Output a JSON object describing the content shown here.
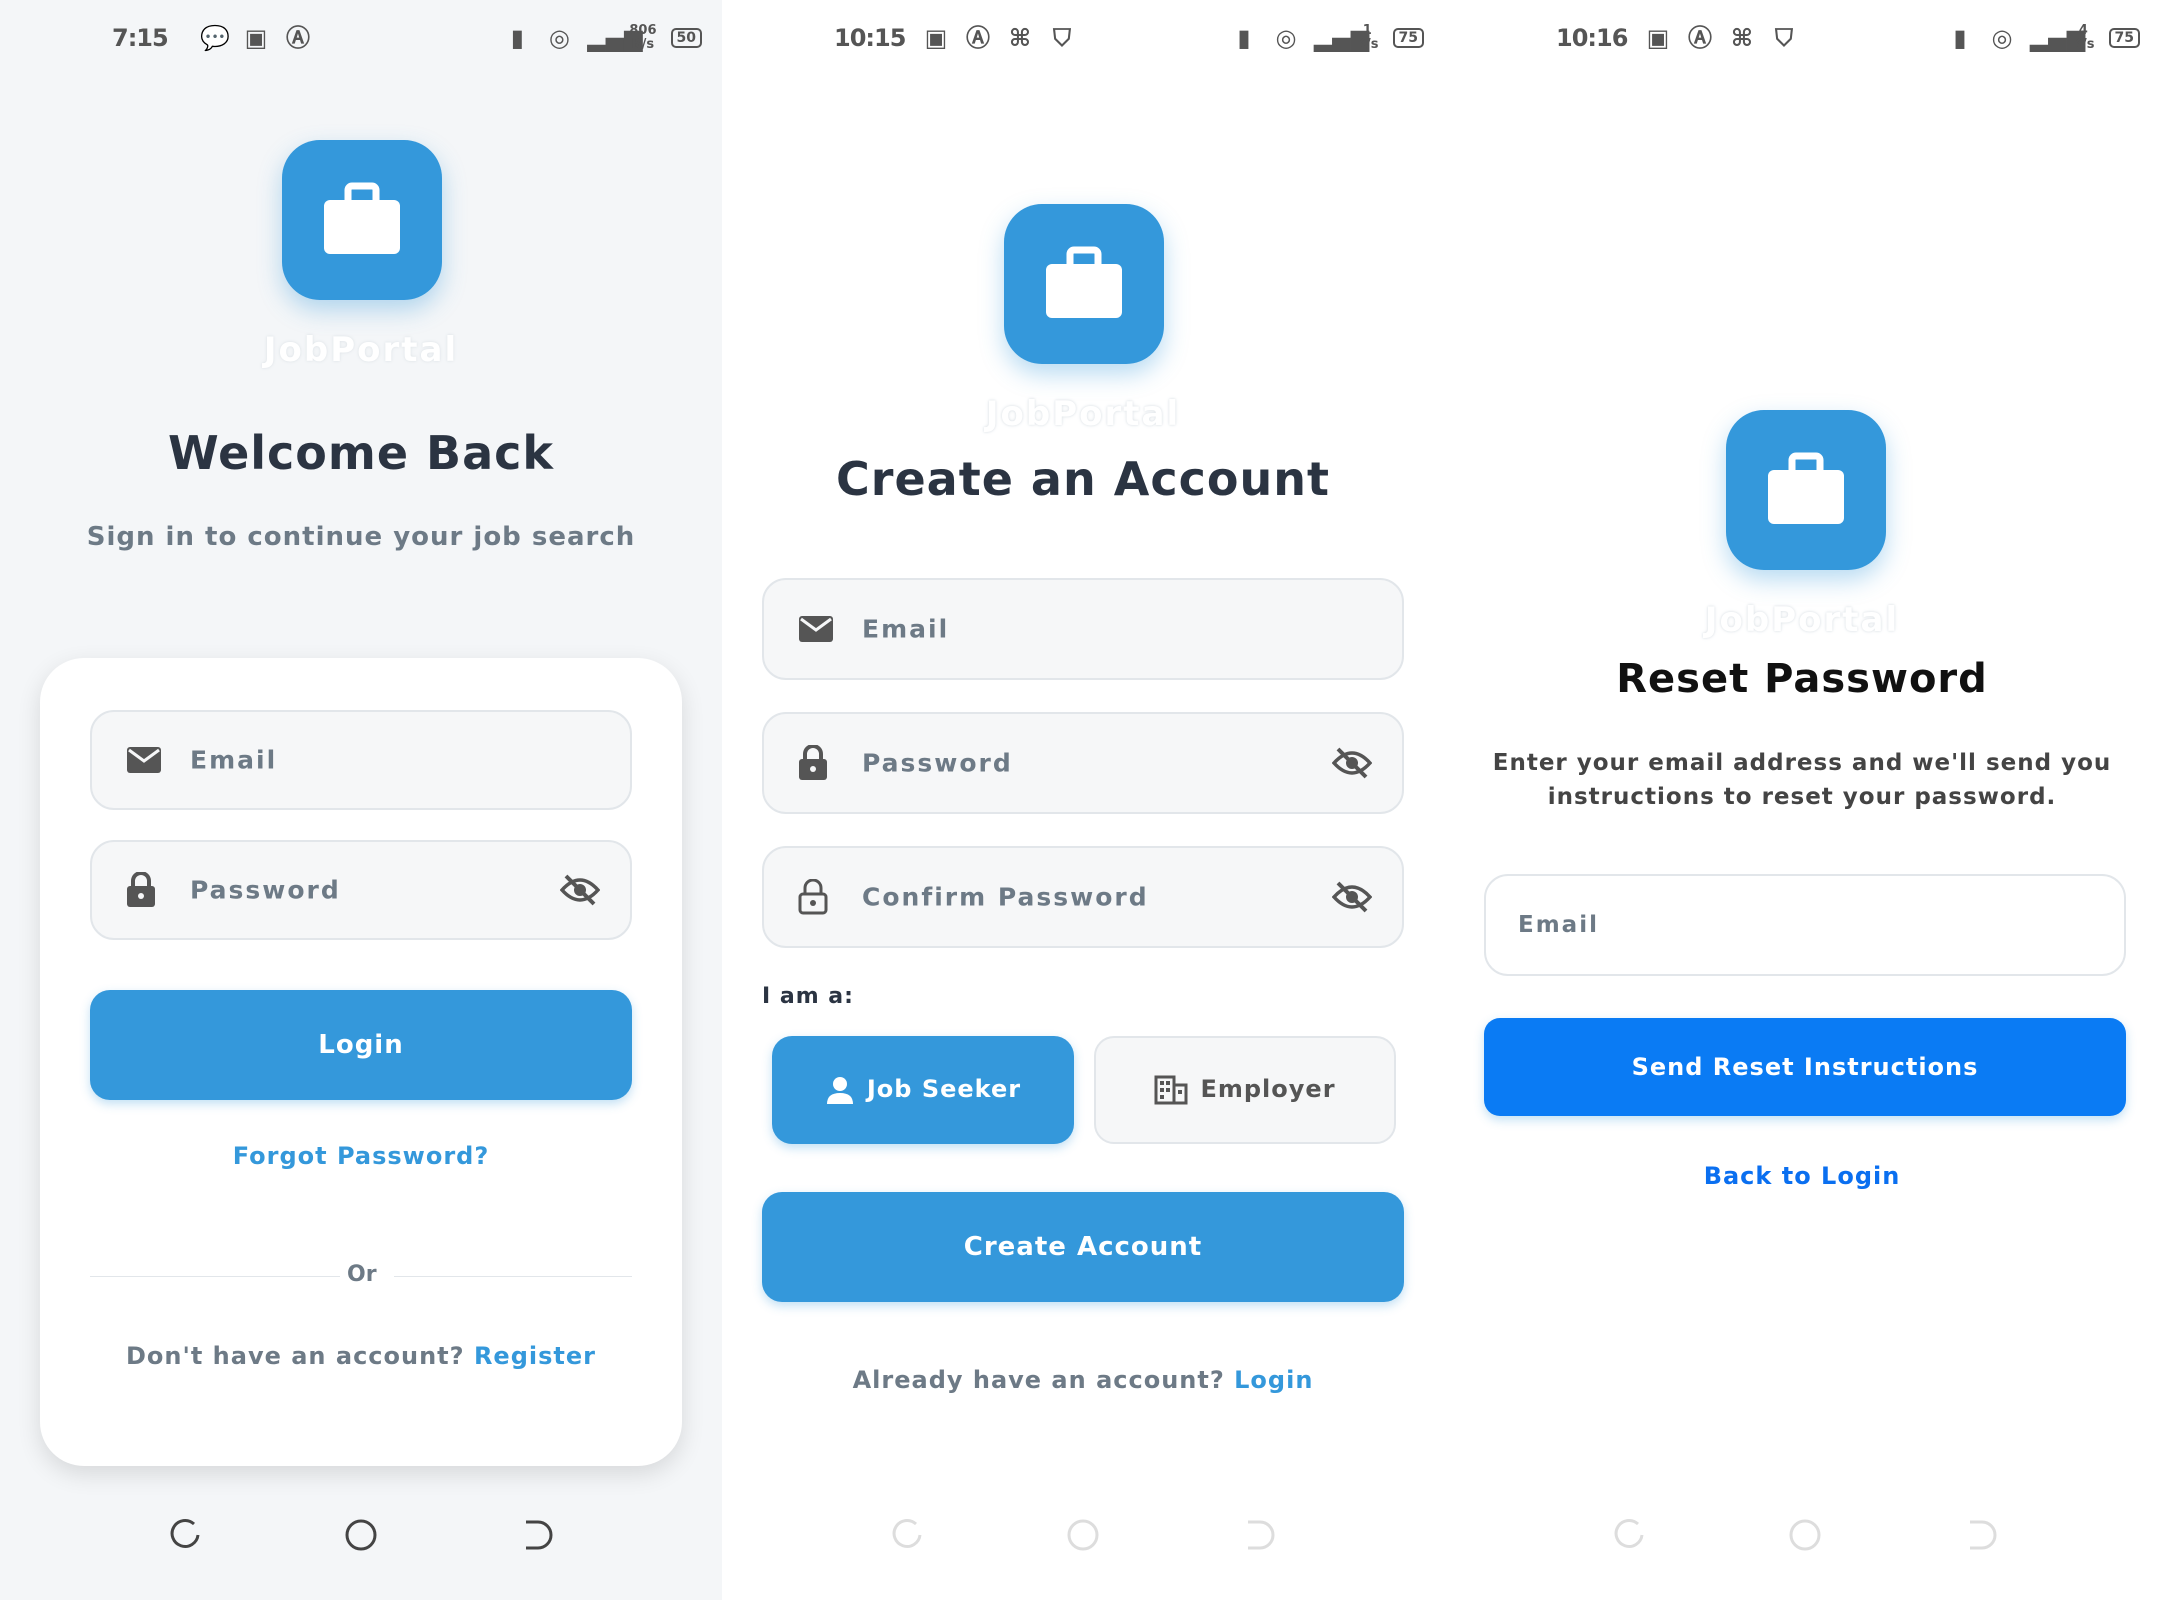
{
  "screens": {
    "login": {
      "status": {
        "time": "7:15",
        "net_speed": "806\nB/s",
        "battery": "50"
      },
      "brand": "JobPortal",
      "title": "Welcome Back",
      "subtitle": "Sign in to continue your job search",
      "email_placeholder": "Email",
      "password_placeholder": "Password",
      "login_button": "Login",
      "forgot_link": "Forgot Password?",
      "or_text": "Or",
      "no_account_text": "Don't have an account? ",
      "register_link": "Register"
    },
    "register": {
      "status": {
        "time": "10:15",
        "net_speed": "1\nK/s",
        "battery": "75"
      },
      "brand": "JobPortal",
      "title": "Create an Account",
      "email_placeholder": "Email",
      "password_placeholder": "Password",
      "confirm_placeholder": "Confirm Password",
      "role_label": "I am a:",
      "role_job_seeker": "Job Seeker",
      "role_employer": "Employer",
      "create_button": "Create Account",
      "have_account_text": "Already have an account? ",
      "login_link": "Login"
    },
    "reset": {
      "status": {
        "time": "10:16",
        "net_speed": "4\nK/s",
        "battery": "75"
      },
      "brand": "JobPortal",
      "title": "Reset Password",
      "subtitle_line1": "Enter your email address and we'll send you",
      "subtitle_line2": "instructions to reset your password.",
      "email_placeholder": "Email",
      "send_button": "Send Reset Instructions",
      "back_link": "Back to Login"
    }
  },
  "colors": {
    "primary": "#3498db",
    "bright_primary": "#0a7bf4",
    "title": "#2b3442",
    "muted": "#6d7a86"
  }
}
